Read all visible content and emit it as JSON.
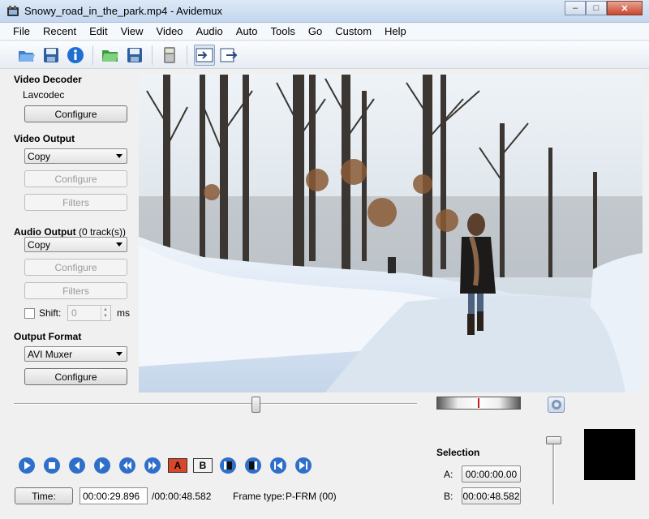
{
  "window": {
    "title": "Snowy_road_in_the_park.mp4 - Avidemux",
    "controls": [
      "–",
      "□",
      "✕"
    ]
  },
  "menu": [
    "File",
    "Recent",
    "Edit",
    "View",
    "Video",
    "Audio",
    "Auto",
    "Tools",
    "Go",
    "Custom",
    "Help"
  ],
  "toolbar": {
    "icons": [
      "open-icon",
      "save-video-icon",
      "info-icon",
      "open-folder-icon",
      "save-icon",
      "calculator-icon",
      "input-mode-icon",
      "output-mode-icon"
    ]
  },
  "video_decoder": {
    "title": "Video Decoder",
    "codec": "Lavcodec",
    "configure": "Configure"
  },
  "video_output": {
    "title": "Video Output",
    "codec": "Copy",
    "configure": "Configure",
    "filters": "Filters"
  },
  "audio_output": {
    "title": "Audio Output",
    "tracks": "(0 track(s))",
    "codec": "Copy",
    "configure": "Configure",
    "filters": "Filters",
    "shift_label": "Shift:",
    "shift_value": "0",
    "shift_unit": "ms"
  },
  "output_format": {
    "title": "Output Format",
    "muxer": "AVI Muxer",
    "configure": "Configure"
  },
  "playback": {
    "position_fraction": 0.6,
    "a_marker_label": "A",
    "b_marker_label": "B"
  },
  "selection": {
    "title": "Selection",
    "a_label": "A:",
    "a_value": "00:00:00.00",
    "b_label": "B:",
    "b_value": "00:00:48.582"
  },
  "status": {
    "time_button": "Time:",
    "current_time": "00:00:29.896",
    "total_time": "/00:00:48.582",
    "frame_type_label": "Frame type:",
    "frame_type_value": "P-FRM (00)"
  }
}
